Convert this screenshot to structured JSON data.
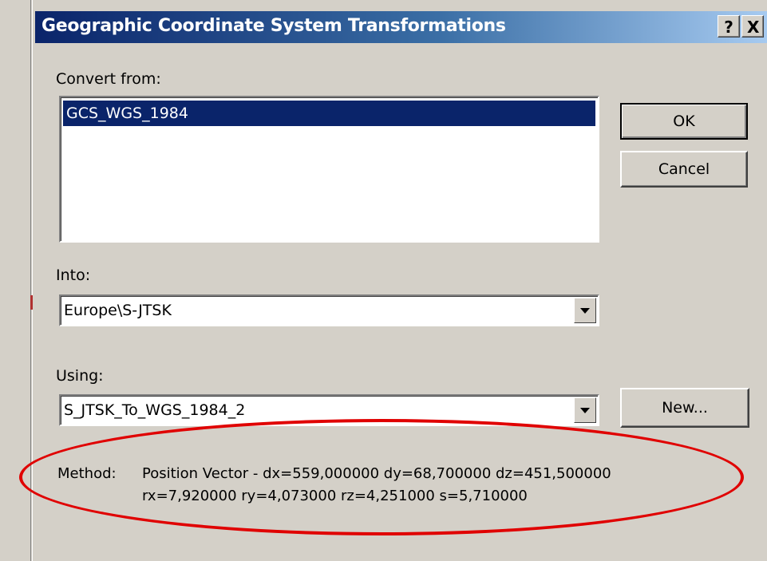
{
  "window": {
    "title": "Geographic Coordinate System Transformations",
    "help_glyph": "?",
    "close_glyph": "X"
  },
  "convert_from": {
    "label": "Convert from:",
    "items": [
      "GCS_WGS_1984"
    ],
    "selected": "GCS_WGS_1984"
  },
  "into": {
    "label": "Into:",
    "value": "Europe\\S-JTSK"
  },
  "using": {
    "label": "Using:",
    "value": "S_JTSK_To_WGS_1984_2"
  },
  "buttons": {
    "ok": "OK",
    "cancel": "Cancel",
    "new": "New..."
  },
  "method": {
    "label": "Method:",
    "line1": "Position Vector - dx=559,000000 dy=68,700000 dz=451,500000",
    "line2": "rx=7,920000 ry=4,073000 rz=4,251000 s=5,710000"
  },
  "colors": {
    "selection": "#0a246a",
    "annotation": "#e00000",
    "face": "#d4d0c8"
  }
}
